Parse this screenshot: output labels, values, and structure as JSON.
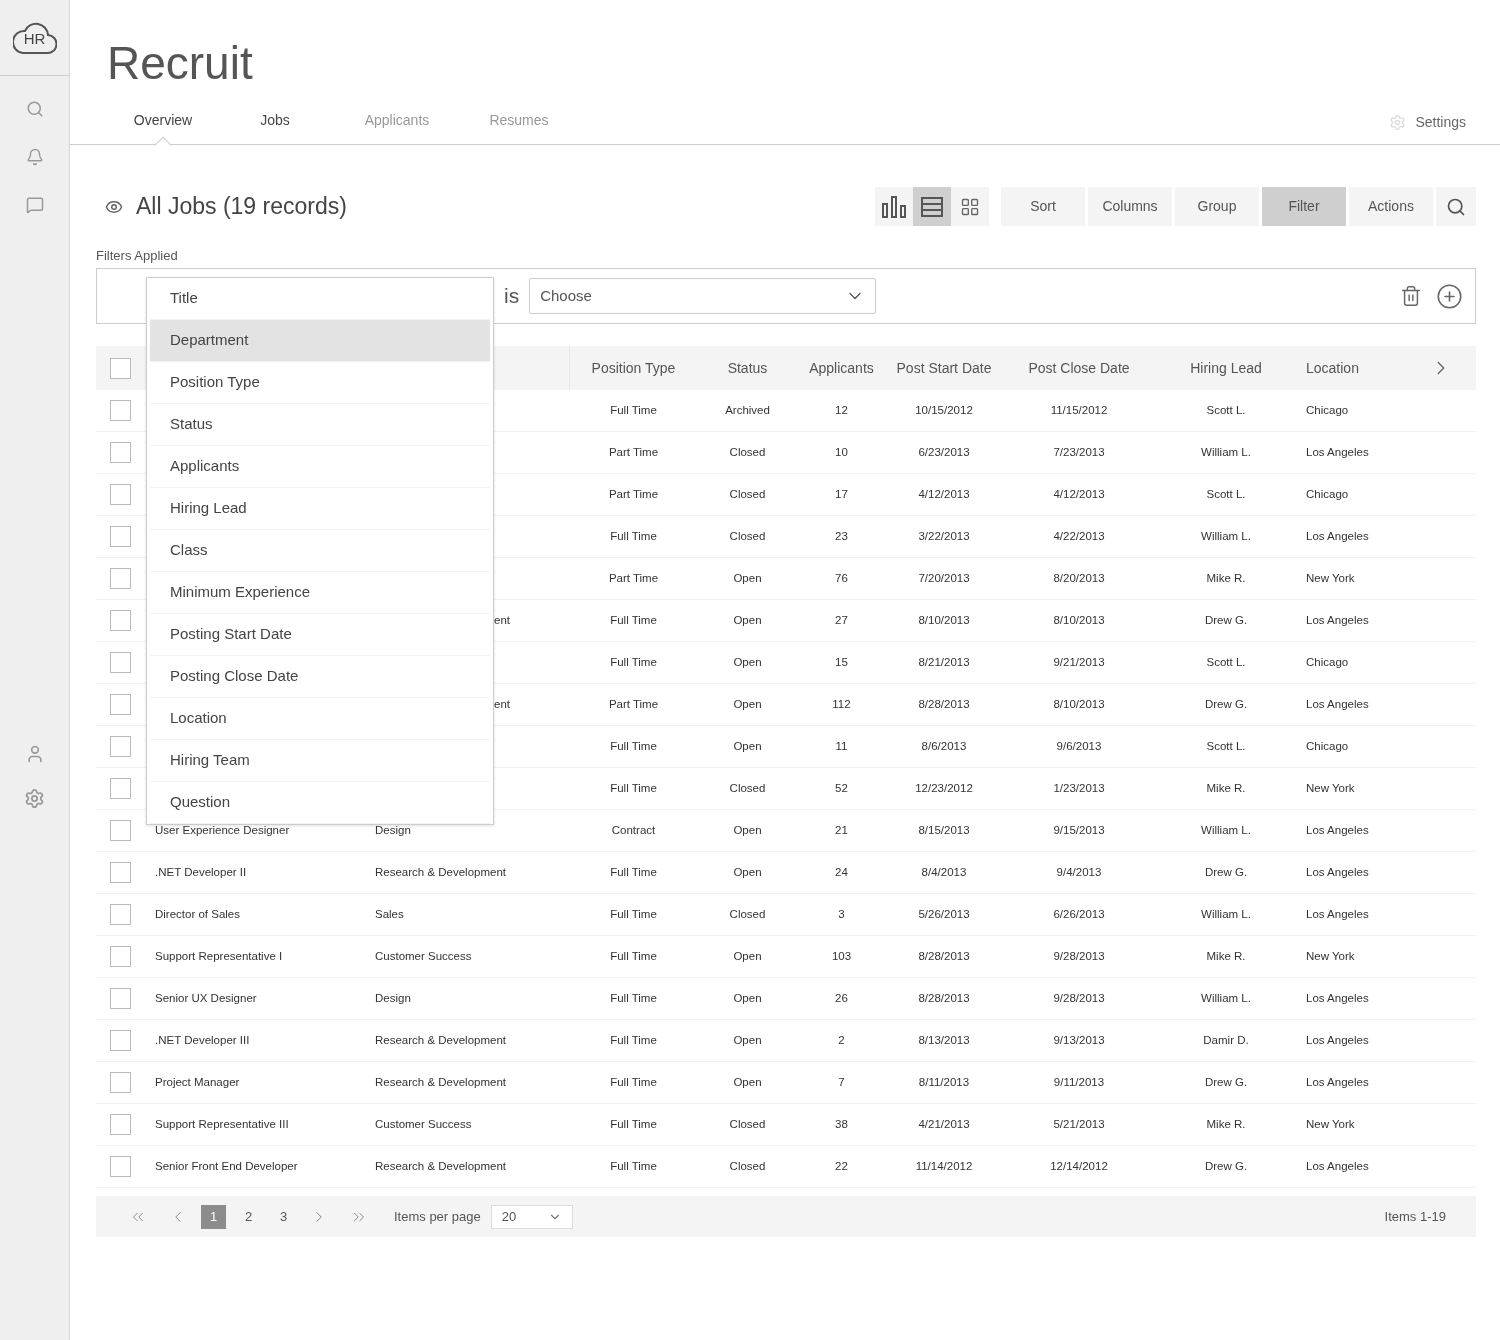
{
  "logo": {
    "text": "HR"
  },
  "page_title": "Recruit",
  "tabs": [
    {
      "label": "Overview",
      "selected": true,
      "disabled": false
    },
    {
      "label": "Jobs",
      "selected": false,
      "disabled": false
    },
    {
      "label": "Applicants",
      "selected": false,
      "disabled": true
    },
    {
      "label": "Resumes",
      "selected": false,
      "disabled": true
    }
  ],
  "settings_link": "Settings",
  "list_title": "All Jobs (19 records)",
  "views": [
    {
      "kind": "chart",
      "selected": false
    },
    {
      "kind": "list",
      "selected": true
    },
    {
      "kind": "grid",
      "selected": false
    }
  ],
  "toolbar": [
    {
      "label": "Sort",
      "selected": false
    },
    {
      "label": "Columns",
      "selected": false
    },
    {
      "label": "Group",
      "selected": false
    },
    {
      "label": "Filter",
      "selected": true
    },
    {
      "label": "Actions",
      "selected": false
    }
  ],
  "filters": {
    "heading": "Filters Applied",
    "operator": "is",
    "value_placeholder": "Choose",
    "field_menu": [
      {
        "label": "Title",
        "selected": false
      },
      {
        "label": "Department",
        "selected": true
      },
      {
        "label": "Position Type",
        "selected": false
      },
      {
        "label": "Status",
        "selected": false
      },
      {
        "label": "Applicants",
        "selected": false
      },
      {
        "label": "Hiring Lead",
        "selected": false
      },
      {
        "label": "Class",
        "selected": false
      },
      {
        "label": "Minimum Experience",
        "selected": false
      },
      {
        "label": "Posting Start Date",
        "selected": false
      },
      {
        "label": "Posting Close Date",
        "selected": false
      },
      {
        "label": "Location",
        "selected": false
      },
      {
        "label": "Hiring Team",
        "selected": false
      },
      {
        "label": "Question",
        "selected": false
      }
    ]
  },
  "table": {
    "all_checked": false,
    "columns": [
      "Position Type",
      "Status",
      "Applicants",
      "Post Start Date",
      "Post Close Date",
      "Hiring Lead",
      "Location"
    ],
    "rows": [
      {
        "checked": false,
        "cells": [
          "Full Time",
          "Archived",
          "12",
          "10/15/2012",
          "11/15/2012",
          "Scott L.",
          "Chicago"
        ]
      },
      {
        "checked": false,
        "cells": [
          "Part Time",
          "Closed",
          "10",
          "6/23/2013",
          "7/23/2013",
          "William L.",
          "Los Angeles"
        ]
      },
      {
        "checked": false,
        "cells": [
          "Part Time",
          "Closed",
          "17",
          "4/12/2013",
          "4/12/2013",
          "Scott L.",
          "Chicago"
        ]
      },
      {
        "checked": false,
        "cells": [
          "Full Time",
          "Closed",
          "23",
          "3/22/2013",
          "4/22/2013",
          "William L.",
          "Los Angeles"
        ]
      },
      {
        "checked": false,
        "cells": [
          "Part Time",
          "Open",
          "76",
          "7/20/2013",
          "8/20/2013",
          "Mike R.",
          "New York"
        ]
      },
      {
        "checked": false,
        "department": "ent",
        "cells": [
          "Full Time",
          "Open",
          "27",
          "8/10/2013",
          "8/10/2013",
          "Drew G.",
          "Los Angeles"
        ]
      },
      {
        "checked": false,
        "cells": [
          "Full Time",
          "Open",
          "15",
          "8/21/2013",
          "9/21/2013",
          "Scott L.",
          "Chicago"
        ]
      },
      {
        "checked": false,
        "department": "ent",
        "cells": [
          "Part Time",
          "Open",
          "112",
          "8/28/2013",
          "8/10/2013",
          "Drew G.",
          "Los Angeles"
        ]
      },
      {
        "checked": false,
        "cells": [
          "Full Time",
          "Open",
          "11",
          "8/6/2013",
          "9/6/2013",
          "Scott L.",
          "Chicago"
        ]
      },
      {
        "checked": false,
        "cells": [
          "Full Time",
          "Closed",
          "52",
          "12/23/2012",
          "1/23/2013",
          "Mike R.",
          "New York"
        ]
      },
      {
        "checked": false,
        "title": "User Experience Designer",
        "department": "Design",
        "cells": [
          "Contract",
          "Open",
          "21",
          "8/15/2013",
          "9/15/2013",
          "William L.",
          "Los Angeles"
        ]
      },
      {
        "checked": false,
        "title": ".NET Developer II",
        "department": "Research & Development",
        "cells": [
          "Full Time",
          "Open",
          "24",
          "8/4/2013",
          "9/4/2013",
          "Drew G.",
          "Los Angeles"
        ]
      },
      {
        "checked": false,
        "title": "Director of Sales",
        "department": "Sales",
        "cells": [
          "Full Time",
          "Closed",
          "3",
          "5/26/2013",
          "6/26/2013",
          "William L.",
          "Los Angeles"
        ]
      },
      {
        "checked": false,
        "title": "Support Representative I",
        "department": "Customer Success",
        "cells": [
          "Full Time",
          "Open",
          "103",
          "8/28/2013",
          "9/28/2013",
          "Mike R.",
          "New York"
        ]
      },
      {
        "checked": false,
        "title": "Senior UX Designer",
        "department": "Design",
        "cells": [
          "Full Time",
          "Open",
          "26",
          "8/28/2013",
          "9/28/2013",
          "William L.",
          "Los Angeles"
        ]
      },
      {
        "checked": false,
        "title": ".NET Developer III",
        "department": "Research & Development",
        "cells": [
          "Full Time",
          "Open",
          "2",
          "8/13/2013",
          "9/13/2013",
          "Damir D.",
          "Los Angeles"
        ]
      },
      {
        "checked": false,
        "title": "Project Manager",
        "department": "Research & Development",
        "cells": [
          "Full Time",
          "Open",
          "7",
          "8/11/2013",
          "9/11/2013",
          "Drew G.",
          "Los Angeles"
        ]
      },
      {
        "checked": false,
        "title": "Support Representative III",
        "department": "Customer Success",
        "cells": [
          "Full Time",
          "Closed",
          "38",
          "4/21/2013",
          "5/21/2013",
          "Mike R.",
          "New York"
        ]
      },
      {
        "checked": false,
        "title": "Senior Front End Developer",
        "department": "Research & Development",
        "cells": [
          "Full Time",
          "Closed",
          "22",
          "11/14/2012",
          "12/14/2012",
          "Drew G.",
          "Los Angeles"
        ]
      }
    ]
  },
  "pagination": {
    "pages": [
      {
        "label": "1",
        "selected": true
      },
      {
        "label": "2",
        "selected": false
      },
      {
        "label": "3",
        "selected": false
      }
    ],
    "per_page_label": "Items per page",
    "per_page_value": "20",
    "range": "Items 1-19"
  }
}
